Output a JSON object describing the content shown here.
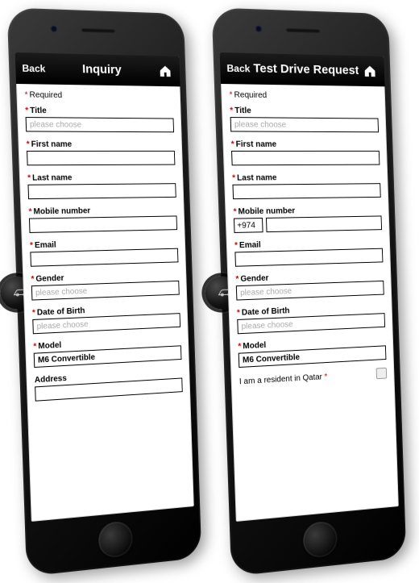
{
  "left": {
    "nav": {
      "back": "Back",
      "title": "Inquiry"
    },
    "required_note": "Required",
    "fields": {
      "title_label": "Title",
      "title_placeholder": "please choose",
      "first_name_label": "First name",
      "last_name_label": "Last name",
      "mobile_label": "Mobile number",
      "email_label": "Email",
      "gender_label": "Gender",
      "gender_placeholder": "please choose",
      "dob_label": "Date of Birth",
      "dob_placeholder": "please choose",
      "model_label": "Model",
      "model_value": "M6 Convertible",
      "address_label": "Address"
    }
  },
  "right": {
    "nav": {
      "back": "Back",
      "title": "Test Drive Request"
    },
    "required_note": "Required",
    "fields": {
      "title_label": "Title",
      "title_placeholder": "please choose",
      "first_name_label": "First name",
      "last_name_label": "Last name",
      "mobile_label": "Mobile number",
      "mobile_prefix": "+974",
      "email_label": "Email",
      "gender_label": "Gender",
      "gender_placeholder": "please choose",
      "dob_label": "Date of Birth",
      "dob_placeholder": "please choose",
      "model_label": "Model",
      "model_value": "M6 Convertible",
      "resident_label": "I am a resident in Qatar"
    }
  }
}
